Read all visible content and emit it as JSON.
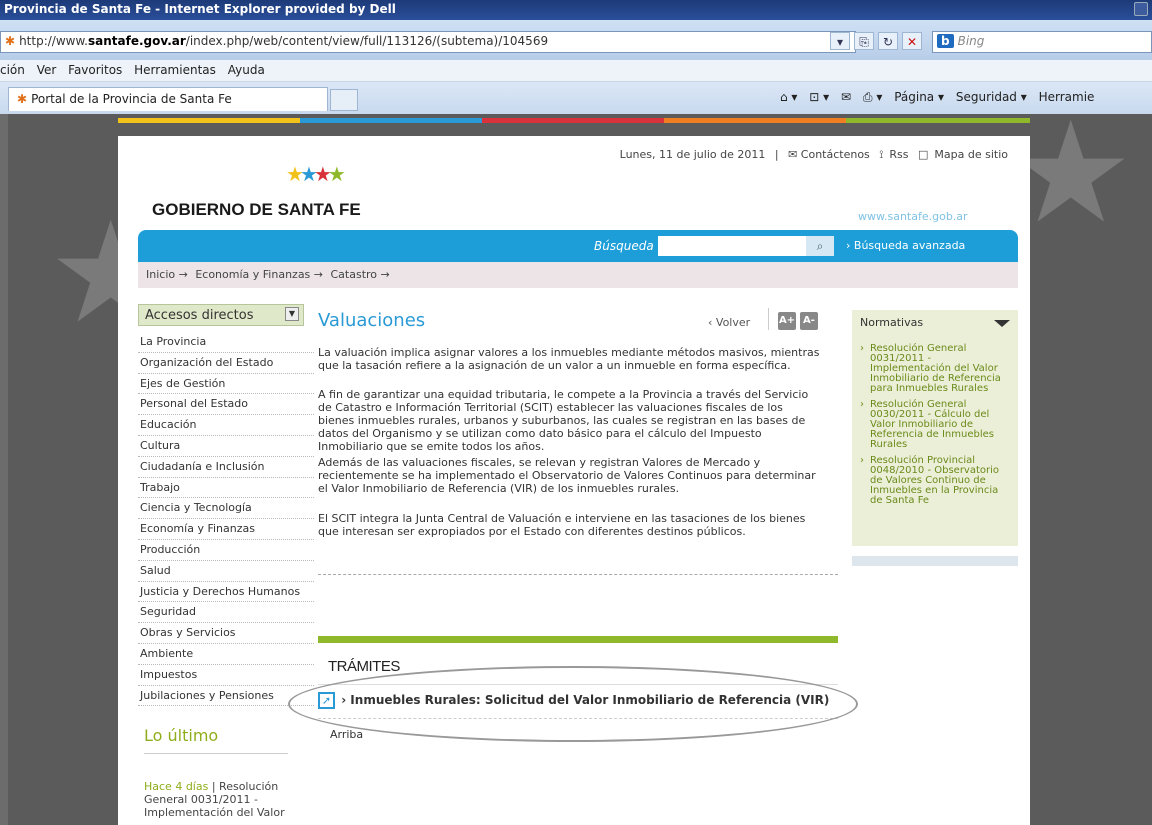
{
  "browser": {
    "title": "Provincia de Santa Fe - Internet Explorer provided by Dell",
    "url_prefix": "http://www.",
    "url_domain": "santafe.gov.ar",
    "url_path": "/index.php/web/content/view/full/113126/(subtema)/104569",
    "search_placeholder": "Bing",
    "search_brand": "b",
    "menu": [
      "ción",
      "Ver",
      "Favoritos",
      "Herramientas",
      "Ayuda"
    ],
    "tab_label": "Portal de la Provincia de Santa Fe",
    "commands": [
      "Página ▾",
      "Seguridad ▾",
      "Herramie"
    ]
  },
  "colors": {
    "accent": "#2a9ad6",
    "green": "#8fb92a",
    "bar": [
      "#f2c11a",
      "#2a9ad6",
      "#d8333a",
      "#ef7d22",
      "#8fb92a"
    ]
  },
  "header": {
    "date": "Lunes, 11 de julio de 2011",
    "sep": "|",
    "contact": "✉ Contáctenos",
    "rss": "Rss",
    "sitemap": "Mapa de sitio",
    "logo": "GOBIERNO DE SANTA FE",
    "site_url": "www.santafe.gob.ar"
  },
  "search": {
    "label": "Búsqueda",
    "advanced": "Búsqueda avanzada"
  },
  "breadcrumb": [
    "Inicio →",
    "Economía y Finanzas →",
    "Catastro →"
  ],
  "sidebar": {
    "accesos": "Accesos directos",
    "items": [
      {
        "label": "La Provincia"
      },
      {
        "label": "Organización del Estado"
      },
      {
        "label": "Ejes de Gestión"
      },
      {
        "label": "Personal del Estado"
      },
      {
        "label": "Educación"
      },
      {
        "label": "Cultura"
      },
      {
        "label": "Ciudadanía e Inclusión"
      },
      {
        "label": "Trabajo"
      },
      {
        "label": "Ciencia y Tecnología"
      },
      {
        "label": "Economía y Finanzas"
      },
      {
        "label": "Producción"
      },
      {
        "label": "Salud"
      },
      {
        "label": "Justicia y Derechos Humanos"
      },
      {
        "label": "Seguridad"
      },
      {
        "label": "Obras y Servicios"
      },
      {
        "label": "Ambiente"
      },
      {
        "label": "Impuestos"
      },
      {
        "label": "Jubilaciones y Pensiones"
      }
    ],
    "ultimo_title": "Lo último",
    "ultimo_date": "Hace 4 días",
    "ultimo_text": " | Resolución General 0031/2011 - Implementación del Valor"
  },
  "main": {
    "title": "Valuaciones",
    "volver": "‹ Volver",
    "font_up": "A+",
    "font_down": "A-",
    "paragraphs": [
      "La valuación implica asignar valores a los inmuebles mediante métodos masivos, mientras que la tasación refiere a la asignación de un valor a un inmueble en forma específica.",
      "A fin de garantizar una equidad tributaria, le compete a la Provincia a través del Servicio de Catastro e Información Territorial (SCIT) establecer las valuaciones fiscales de los bienes inmuebles rurales, urbanos y suburbanos, las cuales se registran en las bases de datos del Organismo y se utilizan como dato básico para el cálculo del Impuesto Inmobiliario que se emite todos los años.",
      "Además de las valuaciones fiscales, se relevan y registran Valores de Mercado y recientemente se ha implementado el Observatorio de Valores Continuos para determinar el Valor Inmobiliario de Referencia (VIR) de los inmuebles rurales.",
      "El SCIT integra la Junta Central de Valuación e interviene en las tasaciones de los bienes que interesan ser expropiados por el Estado con diferentes destinos públicos."
    ],
    "tramites_title": "TRÁMITES",
    "tramite_item": "› Inmuebles Rurales: Solicitud del Valor Inmobiliario de Referencia (VIR)",
    "arriba": "Arriba"
  },
  "normativas": {
    "title": "Normativas",
    "items": [
      "Resolución General 0031/2011 - Implementación del Valor Inmobiliario de Referencia para Inmuebles Rurales",
      "Resolución General 0030/2011 - Cálculo del Valor Inmobiliario de Referencia de Inmuebles Rurales",
      "Resolución Provincial 0048/2010 - Observatorio de Valores Continuo de Inmuebles en la Provincia de Santa Fe"
    ]
  }
}
